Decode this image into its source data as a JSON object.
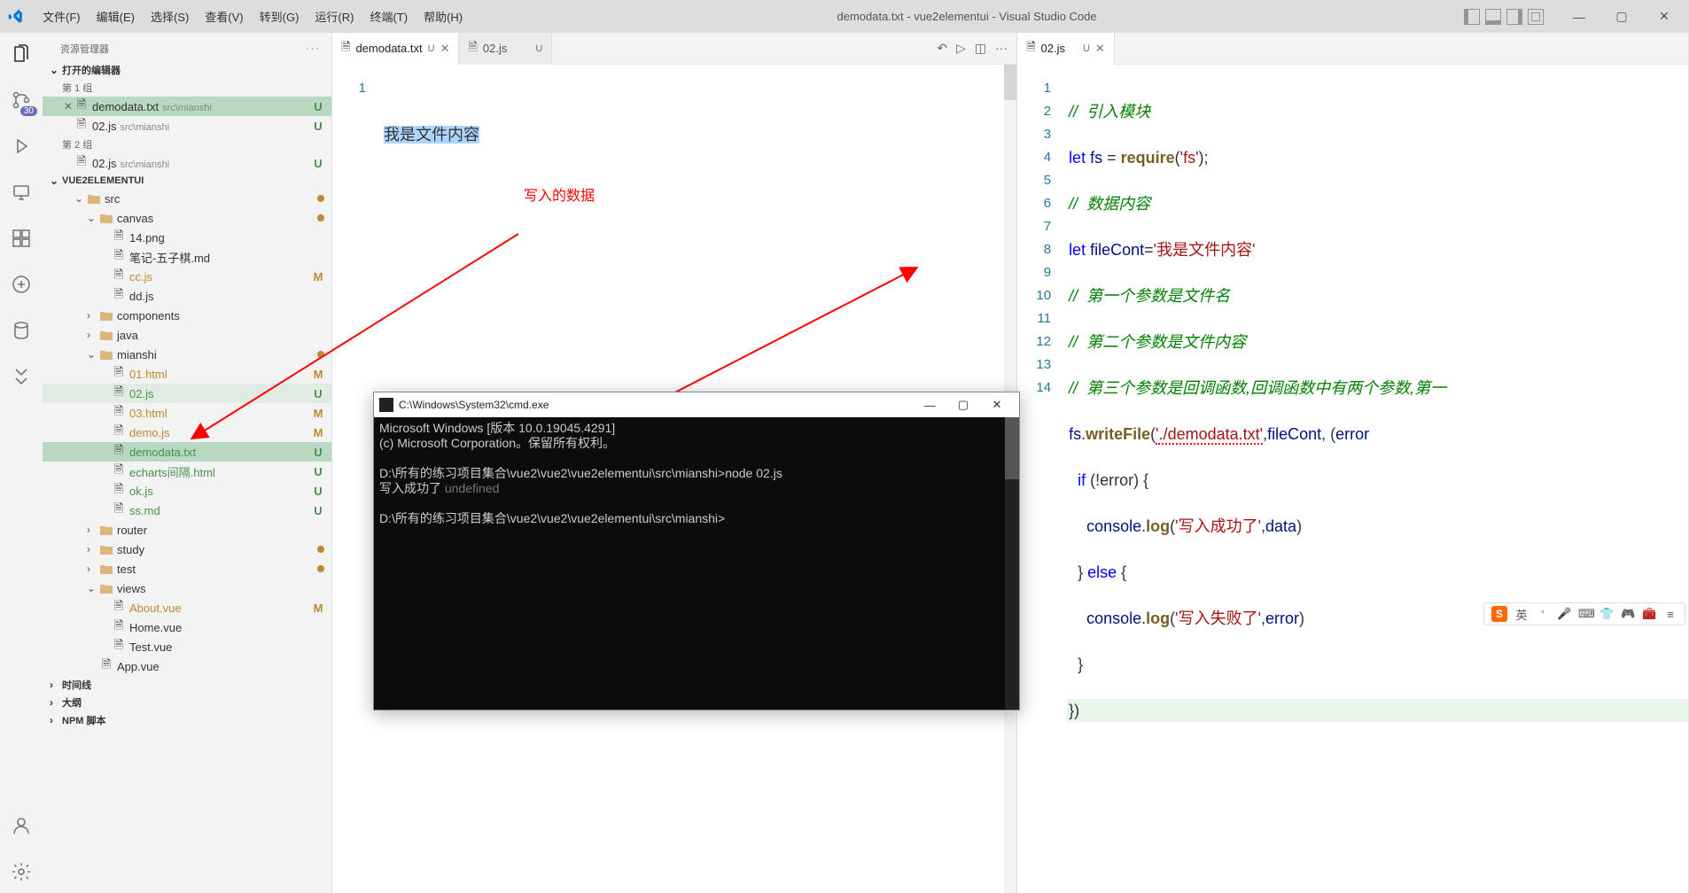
{
  "app": {
    "title": "demodata.txt - vue2elementui - Visual Studio Code"
  },
  "menu": [
    "文件(F)",
    "编辑(E)",
    "选择(S)",
    "查看(V)",
    "转到(G)",
    "运行(R)",
    "终端(T)",
    "帮助(H)"
  ],
  "activity": {
    "badge": "30"
  },
  "sidebar": {
    "title": "资源管理器",
    "sections": {
      "open_editors": "打开的编辑器",
      "group1": "第 1 组",
      "group2": "第 2 组",
      "project": "VUE2ELEMENTUI",
      "timeline": "时间线",
      "outline": "大纲",
      "npm": "NPM 脚本"
    },
    "open_editors": {
      "g1": [
        {
          "name": "demodata.txt",
          "path": "src\\mianshi",
          "status": "U",
          "close": true
        },
        {
          "name": "02.js",
          "path": "src\\mianshi",
          "status": "U"
        }
      ],
      "g2": [
        {
          "name": "02.js",
          "path": "src\\mianshi",
          "status": "U"
        }
      ]
    },
    "tree": [
      {
        "type": "folder",
        "name": "src",
        "indent": 1,
        "open": true,
        "dot": true
      },
      {
        "type": "folder",
        "name": "canvas",
        "indent": 2,
        "open": true,
        "dot": true
      },
      {
        "type": "file",
        "name": "14.png",
        "indent": 3
      },
      {
        "type": "file",
        "name": "笔记-五子棋.md",
        "indent": 3
      },
      {
        "type": "file",
        "name": "cc.js",
        "indent": 3,
        "status": "M"
      },
      {
        "type": "file",
        "name": "dd.js",
        "indent": 3
      },
      {
        "type": "folder",
        "name": "components",
        "indent": 2,
        "open": false
      },
      {
        "type": "folder",
        "name": "java",
        "indent": 2,
        "open": false
      },
      {
        "type": "folder",
        "name": "mianshi",
        "indent": 2,
        "open": true,
        "dot": true
      },
      {
        "type": "file",
        "name": "01.html",
        "indent": 3,
        "status": "M"
      },
      {
        "type": "file",
        "name": "02.js",
        "indent": 3,
        "status": "U",
        "dim": true
      },
      {
        "type": "file",
        "name": "03.html",
        "indent": 3,
        "status": "M"
      },
      {
        "type": "file",
        "name": "demo.js",
        "indent": 3,
        "status": "M"
      },
      {
        "type": "file",
        "name": "demodata.txt",
        "indent": 3,
        "status": "U",
        "selected": true
      },
      {
        "type": "file",
        "name": "echarts间隔.html",
        "indent": 3,
        "status": "U"
      },
      {
        "type": "file",
        "name": "ok.js",
        "indent": 3,
        "status": "U"
      },
      {
        "type": "file",
        "name": "ss.md",
        "indent": 3,
        "status": "U"
      },
      {
        "type": "folder",
        "name": "router",
        "indent": 2,
        "open": false
      },
      {
        "type": "folder",
        "name": "study",
        "indent": 2,
        "open": false,
        "dot": true
      },
      {
        "type": "folder",
        "name": "test",
        "indent": 2,
        "open": false,
        "dot": true
      },
      {
        "type": "folder",
        "name": "views",
        "indent": 2,
        "open": true
      },
      {
        "type": "file",
        "name": "About.vue",
        "indent": 3,
        "status": "M"
      },
      {
        "type": "file",
        "name": "Home.vue",
        "indent": 3
      },
      {
        "type": "file",
        "name": "Test.vue",
        "indent": 3
      },
      {
        "type": "file",
        "name": "App.vue",
        "indent": 2
      }
    ]
  },
  "editor1": {
    "tabs": [
      {
        "name": "demodata.txt",
        "status": "U",
        "active": true,
        "close": true
      },
      {
        "name": "02.js",
        "status": "U"
      }
    ],
    "lines": [
      "1"
    ],
    "content": {
      "l1": "我是文件内容"
    },
    "annotation": "写入的数据"
  },
  "editor2": {
    "tabs": [
      {
        "name": "02.js",
        "status": "U",
        "active": true,
        "close": true
      }
    ],
    "gutter": [
      "1",
      "2",
      "3",
      "4",
      "5",
      "6",
      "7",
      "8",
      "9",
      "10",
      "11",
      "12",
      "13",
      "14"
    ],
    "code": {
      "l1": "//  引入模块",
      "l2_kw": "let",
      "l2_var": " fs ",
      "l2_eq": "= ",
      "l2_fn": "require",
      "l2_rest": "(",
      "l2_str": "'fs'",
      "l2_end": ");",
      "l3": "//  数据内容",
      "l4_kw": "let",
      "l4_var": " fileCont",
      "l4_eq": "=",
      "l4_str": "'我是文件内容'",
      "l5": "//  第一个参数是文件名",
      "l6": "//  第二个参数是文件内容",
      "l7": "//  第三个参数是回调函数,回调函数中有两个参数,第一",
      "l8_obj": "fs",
      "l8_dot": ".",
      "l8_fn": "writeFile",
      "l8_open": "(",
      "l8_str": "'./demodata.txt'",
      "l8_c1": ",",
      "l8_v1": "fileCont",
      "l8_c2": ", (",
      "l8_v2": "error",
      "l9_kw": "if",
      "l9_rest": " (!error) {",
      "l10_obj": "console",
      "l10_dot": ".",
      "l10_fn": "log",
      "l10_open": "(",
      "l10_str": "'写入成功了'",
      "l10_c": ",",
      "l10_v": "data",
      "l10_end": ")",
      "l11": "} ",
      "l11_kw": "else",
      "l11_rest": " {",
      "l12_obj": "console",
      "l12_dot": ".",
      "l12_fn": "log",
      "l12_open": "(",
      "l12_str": "'写入失败了'",
      "l12_c": ",",
      "l12_v": "error",
      "l12_end": ")",
      "l13": "}",
      "l14": "})"
    }
  },
  "cmd": {
    "title": "C:\\Windows\\System32\\cmd.exe",
    "body_l1": "Microsoft Windows [版本 10.0.19045.4291]",
    "body_l2": "(c) Microsoft Corporation。保留所有权利。",
    "body_l3": "",
    "body_l4": "D:\\所有的练习项目集合\\vue2\\vue2\\vue2elementui\\src\\mianshi>node 02.js",
    "body_l5a": "写入成功了 ",
    "body_l5b": "undefined",
    "body_l6": "",
    "body_l7": "D:\\所有的练习项目集合\\vue2\\vue2\\vue2elementui\\src\\mianshi>"
  },
  "ime": {
    "lang": "英"
  }
}
